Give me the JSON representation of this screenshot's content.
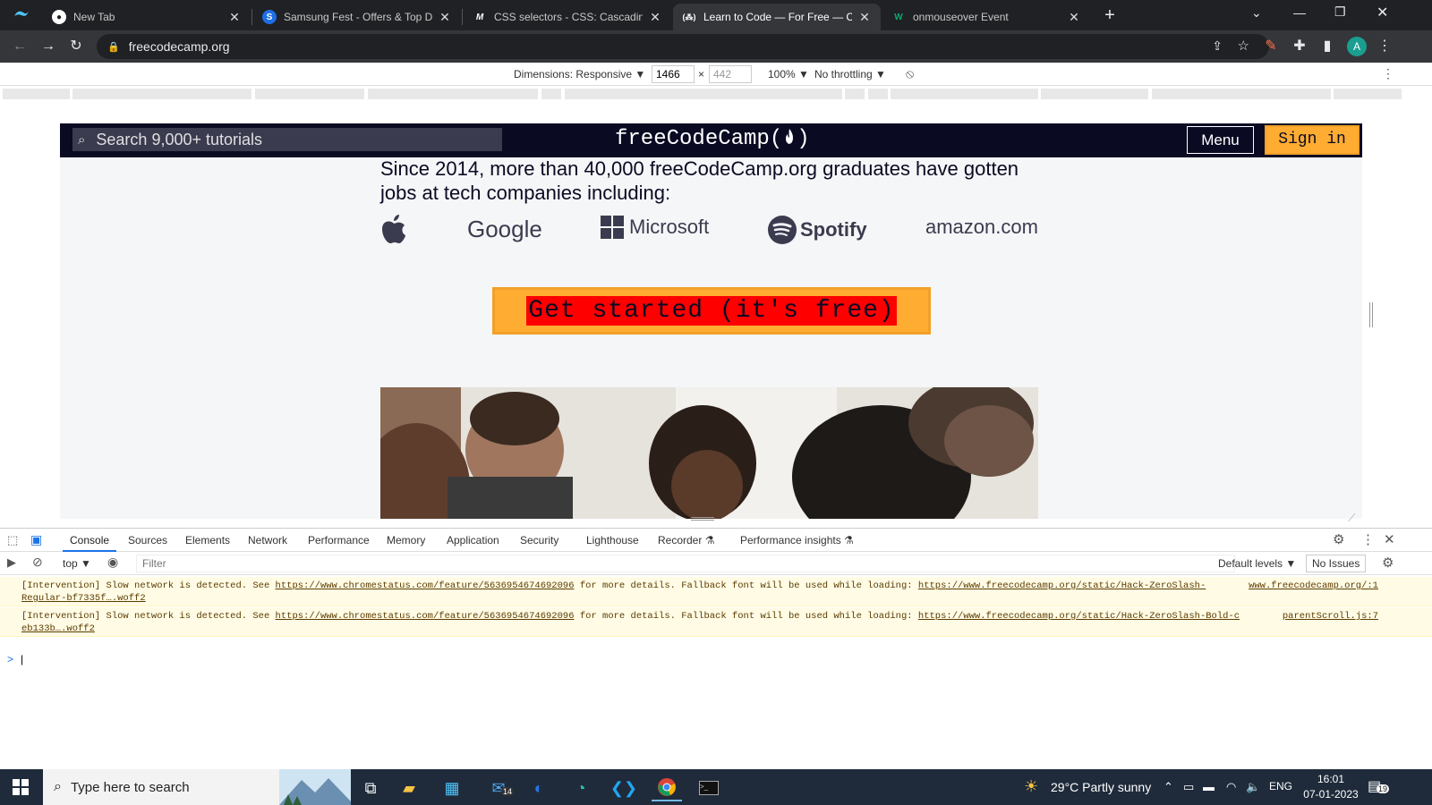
{
  "browser": {
    "tabs": [
      {
        "title": "New Tab",
        "icon": "chrome-icon"
      },
      {
        "title": "Samsung Fest - Offers & Top Dea",
        "icon": "samsung-icon"
      },
      {
        "title": "CSS selectors - CSS: Cascading St",
        "icon": "mdn-icon"
      },
      {
        "title": "Learn to Code — For Free — Cod",
        "icon": "freecodecamp-icon"
      },
      {
        "title": "onmouseover Event",
        "icon": "w3schools-icon"
      }
    ],
    "new_tab_symbol": "+",
    "url": "freecodecamp.org",
    "profile_initial": "A"
  },
  "device_toolbar": {
    "dimensions_label": "Dimensions: Responsive ▼",
    "width": "1466",
    "times": "×",
    "height": "442",
    "zoom": "100% ▼",
    "throttling": "No throttling ▼"
  },
  "site": {
    "search_placeholder": "Search 9,000+ tutorials",
    "logo": "freeCodeCamp(🔥)",
    "logo_text": "freeCodeCamp(",
    "logo_close": ")",
    "menu_label": "Menu",
    "signin_label": "Sign in",
    "headline": "Since 2014, more than 40,000 freeCodeCamp.org graduates have gotten jobs at tech companies including:",
    "companies": {
      "google": "Google",
      "microsoft": "Microsoft",
      "spotify": "Spotify",
      "amazon": "amazon.com"
    },
    "cta_label": "Get started (it's free)"
  },
  "devtools": {
    "tabs": [
      "Console",
      "Sources",
      "Elements",
      "Network",
      "Performance",
      "Memory",
      "Application",
      "Security",
      "Lighthouse",
      "Recorder ⚗",
      "Performance insights ⚗"
    ],
    "context": "top ▼",
    "filter_placeholder": "Filter",
    "levels": "Default levels ▼",
    "issues": "No Issues",
    "messages": [
      {
        "prefix": "[Intervention] Slow network is detected. See ",
        "link1": "https://www.chromestatus.com/feature/5636954674692096",
        "middle": " for more details. Fallback font will be used while loading: ",
        "link2": "https://www.freecodecamp.org/static/Hack-ZeroSlash-",
        "link2b": "Regular-bf7335f….woff2",
        "source": "www.freecodecamp.org/:1"
      },
      {
        "prefix": "[Intervention] Slow network is detected. See ",
        "link1": "https://www.chromestatus.com/feature/5636954674692096",
        "middle": " for more details. Fallback font will be used while loading: ",
        "link2": "https://www.freecodecamp.org/static/Hack-ZeroSlash-Bold-c",
        "link2b": "eb133b….woff2",
        "source": "parentScroll.js:7"
      }
    ],
    "prompt_symbol": ">"
  },
  "taskbar": {
    "search_placeholder": "Type here to search",
    "weather": "29°C  Partly sunny",
    "language": "ENG",
    "time": "16:01",
    "date": "07-01-2023",
    "mail_badge": "14",
    "notification_count": "19"
  },
  "colors": {
    "fcc_navy": "#0a0a23",
    "fcc_yellow": "#feac32",
    "cta_text_bg": "#ff0000",
    "chrome_dark": "#202124",
    "chrome_toolbar": "#35363a",
    "taskbar": "#1f2b3b"
  }
}
